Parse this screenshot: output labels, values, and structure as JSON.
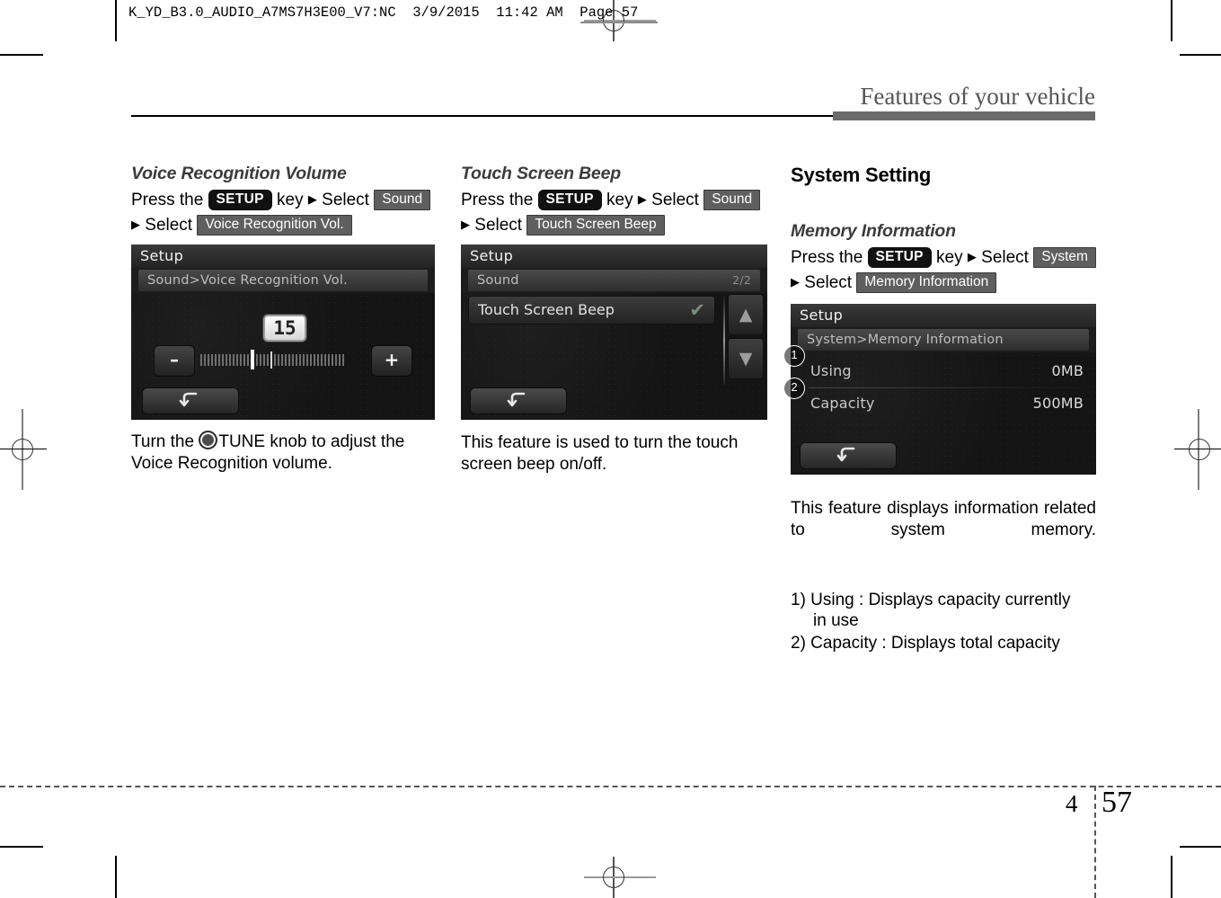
{
  "prepress": {
    "header": "K_YD_B3.0_AUDIO_A7MS7H3E00_V7:NC  3/9/2015  11:42 AM  Page 57"
  },
  "running_head": {
    "title": "Features of your vehicle"
  },
  "footer": {
    "chapter": "4",
    "page": "57"
  },
  "column1": {
    "heading": "Voice Recognition Volume",
    "instruction": {
      "press_the": "Press  the",
      "setup_badge": "SETUP",
      "key_word": "key",
      "select_1": "Select",
      "badge_sound": "Sound",
      "select_2": "Select",
      "badge_target": "Voice Recognition Vol."
    },
    "screen": {
      "title": "Setup",
      "breadcrumb": "Sound>Voice Recognition Vol.",
      "value": "15",
      "minus_label": "–",
      "plus_label": "+",
      "back_label": "back-arrow",
      "slider_total_ticks": 40,
      "slider_active_index": 15,
      "slider_mark_index": 20
    },
    "caption_line1_pre": "Turn the ",
    "caption_knob_icon": "tune-knob",
    "caption_line1_post": "TUNE knob to adjust the",
    "caption_line2": "Voice Recognition volume."
  },
  "column2": {
    "heading": "Touch Screen Beep",
    "instruction": {
      "press_the": "Press  the",
      "setup_badge": "SETUP",
      "key_word": "key",
      "select_1": "Select",
      "badge_sound": "Sound",
      "select_2": "Select",
      "badge_target": "Touch Screen Beep"
    },
    "screen": {
      "title": "Setup",
      "breadcrumb": "Sound",
      "page_indicator": "2/2",
      "row_label": "Touch Screen Beep",
      "row_checked": "✔",
      "scroll_up": "▲",
      "scroll_down": "▼",
      "back_label": "back-arrow"
    },
    "caption": "This feature is used to turn the touch screen beep on/off."
  },
  "column3": {
    "section_heading": "System Setting",
    "heading": "Memory Information",
    "instruction": {
      "press_the": "Press the",
      "setup_badge": "SETUP",
      "key_word": "key",
      "select_1": "Select",
      "badge_system": "System",
      "select_2": "Select",
      "badge_target": "Memory Information"
    },
    "screen": {
      "title": "Setup",
      "breadcrumb": "System>Memory Information",
      "rows": [
        {
          "callout": "1",
          "label": "Using",
          "value": "0MB"
        },
        {
          "callout": "2",
          "label": "Capacity",
          "value": "500MB"
        }
      ],
      "back_label": "back-arrow"
    },
    "caption": "This feature displays information related to system memory.",
    "notes": [
      "1) Using : Displays capacity currently",
      "in use",
      "2) Capacity : Displays total capacity"
    ]
  },
  "colors": {
    "badge_dark": "#111111",
    "badge_gray": "#5f5f5f",
    "rule_gray": "#6b6b6b",
    "head_title": "#555555",
    "device_bg": "#141414"
  }
}
